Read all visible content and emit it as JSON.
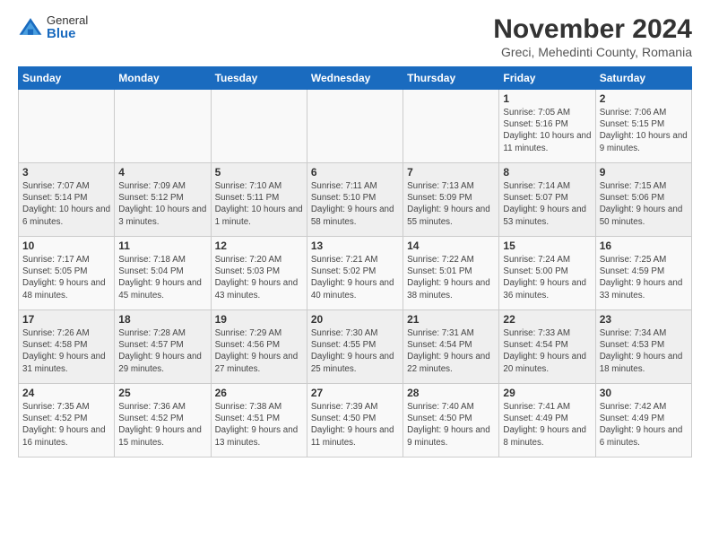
{
  "header": {
    "logo_general": "General",
    "logo_blue": "Blue",
    "month_title": "November 2024",
    "subtitle": "Greci, Mehedinti County, Romania"
  },
  "weekdays": [
    "Sunday",
    "Monday",
    "Tuesday",
    "Wednesday",
    "Thursday",
    "Friday",
    "Saturday"
  ],
  "weeks": [
    [
      {
        "day": "",
        "info": ""
      },
      {
        "day": "",
        "info": ""
      },
      {
        "day": "",
        "info": ""
      },
      {
        "day": "",
        "info": ""
      },
      {
        "day": "",
        "info": ""
      },
      {
        "day": "1",
        "info": "Sunrise: 7:05 AM\nSunset: 5:16 PM\nDaylight: 10 hours and 11 minutes."
      },
      {
        "day": "2",
        "info": "Sunrise: 7:06 AM\nSunset: 5:15 PM\nDaylight: 10 hours and 9 minutes."
      }
    ],
    [
      {
        "day": "3",
        "info": "Sunrise: 7:07 AM\nSunset: 5:14 PM\nDaylight: 10 hours and 6 minutes."
      },
      {
        "day": "4",
        "info": "Sunrise: 7:09 AM\nSunset: 5:12 PM\nDaylight: 10 hours and 3 minutes."
      },
      {
        "day": "5",
        "info": "Sunrise: 7:10 AM\nSunset: 5:11 PM\nDaylight: 10 hours and 1 minute."
      },
      {
        "day": "6",
        "info": "Sunrise: 7:11 AM\nSunset: 5:10 PM\nDaylight: 9 hours and 58 minutes."
      },
      {
        "day": "7",
        "info": "Sunrise: 7:13 AM\nSunset: 5:09 PM\nDaylight: 9 hours and 55 minutes."
      },
      {
        "day": "8",
        "info": "Sunrise: 7:14 AM\nSunset: 5:07 PM\nDaylight: 9 hours and 53 minutes."
      },
      {
        "day": "9",
        "info": "Sunrise: 7:15 AM\nSunset: 5:06 PM\nDaylight: 9 hours and 50 minutes."
      }
    ],
    [
      {
        "day": "10",
        "info": "Sunrise: 7:17 AM\nSunset: 5:05 PM\nDaylight: 9 hours and 48 minutes."
      },
      {
        "day": "11",
        "info": "Sunrise: 7:18 AM\nSunset: 5:04 PM\nDaylight: 9 hours and 45 minutes."
      },
      {
        "day": "12",
        "info": "Sunrise: 7:20 AM\nSunset: 5:03 PM\nDaylight: 9 hours and 43 minutes."
      },
      {
        "day": "13",
        "info": "Sunrise: 7:21 AM\nSunset: 5:02 PM\nDaylight: 9 hours and 40 minutes."
      },
      {
        "day": "14",
        "info": "Sunrise: 7:22 AM\nSunset: 5:01 PM\nDaylight: 9 hours and 38 minutes."
      },
      {
        "day": "15",
        "info": "Sunrise: 7:24 AM\nSunset: 5:00 PM\nDaylight: 9 hours and 36 minutes."
      },
      {
        "day": "16",
        "info": "Sunrise: 7:25 AM\nSunset: 4:59 PM\nDaylight: 9 hours and 33 minutes."
      }
    ],
    [
      {
        "day": "17",
        "info": "Sunrise: 7:26 AM\nSunset: 4:58 PM\nDaylight: 9 hours and 31 minutes."
      },
      {
        "day": "18",
        "info": "Sunrise: 7:28 AM\nSunset: 4:57 PM\nDaylight: 9 hours and 29 minutes."
      },
      {
        "day": "19",
        "info": "Sunrise: 7:29 AM\nSunset: 4:56 PM\nDaylight: 9 hours and 27 minutes."
      },
      {
        "day": "20",
        "info": "Sunrise: 7:30 AM\nSunset: 4:55 PM\nDaylight: 9 hours and 25 minutes."
      },
      {
        "day": "21",
        "info": "Sunrise: 7:31 AM\nSunset: 4:54 PM\nDaylight: 9 hours and 22 minutes."
      },
      {
        "day": "22",
        "info": "Sunrise: 7:33 AM\nSunset: 4:54 PM\nDaylight: 9 hours and 20 minutes."
      },
      {
        "day": "23",
        "info": "Sunrise: 7:34 AM\nSunset: 4:53 PM\nDaylight: 9 hours and 18 minutes."
      }
    ],
    [
      {
        "day": "24",
        "info": "Sunrise: 7:35 AM\nSunset: 4:52 PM\nDaylight: 9 hours and 16 minutes."
      },
      {
        "day": "25",
        "info": "Sunrise: 7:36 AM\nSunset: 4:52 PM\nDaylight: 9 hours and 15 minutes."
      },
      {
        "day": "26",
        "info": "Sunrise: 7:38 AM\nSunset: 4:51 PM\nDaylight: 9 hours and 13 minutes."
      },
      {
        "day": "27",
        "info": "Sunrise: 7:39 AM\nSunset: 4:50 PM\nDaylight: 9 hours and 11 minutes."
      },
      {
        "day": "28",
        "info": "Sunrise: 7:40 AM\nSunset: 4:50 PM\nDaylight: 9 hours and 9 minutes."
      },
      {
        "day": "29",
        "info": "Sunrise: 7:41 AM\nSunset: 4:49 PM\nDaylight: 9 hours and 8 minutes."
      },
      {
        "day": "30",
        "info": "Sunrise: 7:42 AM\nSunset: 4:49 PM\nDaylight: 9 hours and 6 minutes."
      }
    ]
  ]
}
